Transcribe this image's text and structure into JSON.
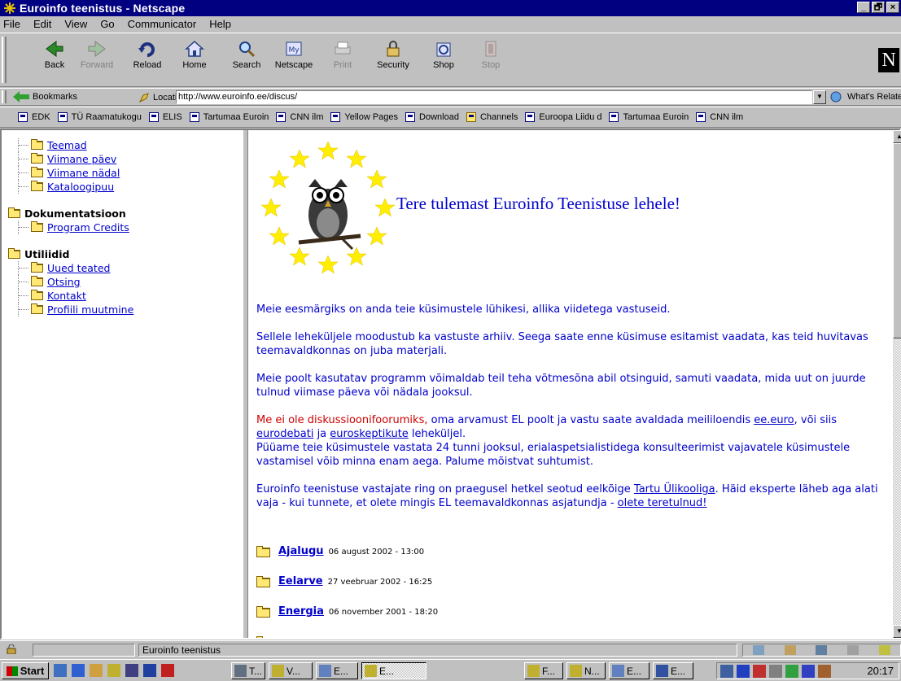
{
  "window": {
    "title": "Euroinfo teenistus - Netscape",
    "min": "_",
    "max": "🗗",
    "close": "×"
  },
  "menu": [
    "File",
    "Edit",
    "View",
    "Go",
    "Communicator",
    "Help"
  ],
  "nav_buttons": [
    {
      "label": "Back",
      "icon": "back-arrow-icon",
      "enabled": true
    },
    {
      "label": "Forward",
      "icon": "forward-arrow-icon",
      "enabled": false
    },
    {
      "label": "Reload",
      "icon": "reload-icon",
      "enabled": true
    },
    {
      "label": "Home",
      "icon": "home-icon",
      "enabled": true
    },
    {
      "label": "Search",
      "icon": "search-icon",
      "enabled": true
    },
    {
      "label": "Netscape",
      "icon": "netscape-icon",
      "enabled": true
    },
    {
      "label": "Print",
      "icon": "print-icon",
      "enabled": false
    },
    {
      "label": "Security",
      "icon": "lock-icon",
      "enabled": true
    },
    {
      "label": "Shop",
      "icon": "shop-icon",
      "enabled": true
    },
    {
      "label": "Stop",
      "icon": "stop-icon",
      "enabled": false
    }
  ],
  "location": {
    "bookmarks_label": "Bookmarks",
    "location_label": "Location:",
    "url": "http://www.euroinfo.ee/discus/",
    "related_label": "What's Related"
  },
  "personal_toolbar": [
    "EDK",
    "TÜ Raamatukogu",
    "ELIS",
    "Tartumaa Euroin",
    "CNN ilm",
    "Yellow Pages",
    "Download",
    "Channels",
    "Euroopa Liidu d",
    "Tartumaa Euroin",
    "CNN ilm"
  ],
  "left_tree": {
    "top_items": [
      "Teemad",
      "Viimane päev",
      "Viimane nädal",
      "Kataloogipuu"
    ],
    "groups": [
      {
        "title": "Dokumentatsioon",
        "items": [
          "Program Credits"
        ]
      },
      {
        "title": "Utiliidid",
        "items": [
          "Uued teated",
          "Otsing",
          "Kontakt",
          "Profiili muutmine"
        ]
      }
    ]
  },
  "main": {
    "welcome": "Tere tulemast Euroinfo Teenistuse lehele",
    "welcome_bang": "!",
    "p1": "Meie eesmärgiks on anda teie küsimustele lühikesi, allika viidetega vastuseid.",
    "p2": "Sellele leheküljele moodustub ka vastuste arhiiv. Seega saate enne küsimuse esitamist vaadata, kas teid huvitavas teemavaldkonnas on juba materjali.",
    "p3": "Meie poolt kasutatav programm võimaldab teil teha võtmesõna abil otsinguid, samuti vaadata, mida uut on juurde tulnud viimase päeva või nädala jooksul.",
    "p4_red": "Me ei ole diskussioonifoorumiks,",
    "p4_a": " oma arvamust EL poolt ja vastu saate avaldada meililoendis ",
    "p4_link1": "ee.euro",
    "p4_b": ", või siis ",
    "p4_link2": "eurodebati",
    "p4_c": " ja ",
    "p4_link3": "euroskeptikute",
    "p4_d": " leheküljel.",
    "p4_e": "Püüame teie küsimustele vastata 24 tunni jooksul, erialaspetsialistidega konsulteerimist vajavatele küsimustele vastamisel võib minna enam aega. Palume mõistvat suhtumist.",
    "p5_a": "Euroinfo teenistuse vastajate ring on praegusel hetkel seotud eelkõige ",
    "p5_link1": "Tartu Ülikooliga",
    "p5_b": ". Häid eksperte läheb aga alati vaja - kui tunnete, et olete mingis EL teemavaldkonnas asjatundja - ",
    "p5_link2": "olete teretulnud!",
    "topics": [
      {
        "name": "Ajalugu",
        "date": "06 august 2002 - 13:00"
      },
      {
        "name": "Eelarve",
        "date": "27 veebruar 2002 - 16:25"
      },
      {
        "name": "Energia",
        "date": "06 november 2001 - 18:20"
      }
    ]
  },
  "status": {
    "message": "Euroinfo teenistus"
  },
  "taskbar": {
    "start": "Start",
    "tasks": [
      "T...",
      "V...",
      "E...",
      "E...",
      "F...",
      "N...",
      "E...",
      "E..."
    ],
    "clock": "20:17"
  },
  "colors": {
    "title_bg": "#000080",
    "link": "#0000cc",
    "alert": "#cc0000",
    "chrome": "#c0c0c0"
  }
}
